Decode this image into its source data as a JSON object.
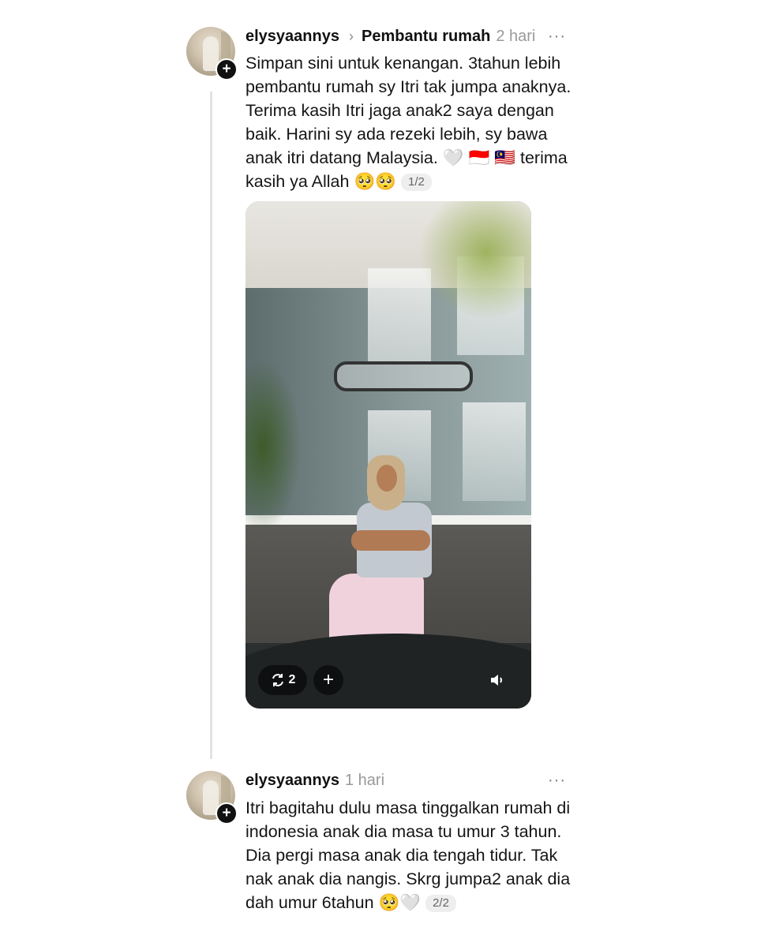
{
  "posts": [
    {
      "username": "elysyaannys",
      "topic": "Pembantu rumah",
      "time": "2 hari",
      "more": "···",
      "text": "Simpan sini untuk kenangan. 3tahun lebih pembantu rumah sy Itri tak jumpa anaknya. Terima kasih Itri jaga anak2 saya dengan baik. Harini sy ada rezeki lebih, sy bawa anak itri datang Malaysia. 🤍 🇮🇩 🇲🇾 terima kasih ya Allah 🥺🥺",
      "page": "1/2",
      "media": {
        "repost_count": "2",
        "icons": [
          "repost-icon",
          "add-icon",
          "volume-icon"
        ]
      }
    },
    {
      "username": "elysyaannys",
      "time": "1 hari",
      "more": "···",
      "text": "Itri bagitahu dulu masa tinggalkan rumah di indonesia anak dia masa tu umur 3 tahun. Dia pergi masa anak dia tengah tidur. Tak nak anak dia nangis. Skrg jumpa2 anak dia dah umur 6tahun 🥺🤍",
      "page": "2/2"
    }
  ],
  "follow_icon": "plus-icon",
  "colors": {
    "text": "#151515",
    "muted": "#999999",
    "thread_line": "#e3e3e3",
    "badge": "#111111"
  }
}
